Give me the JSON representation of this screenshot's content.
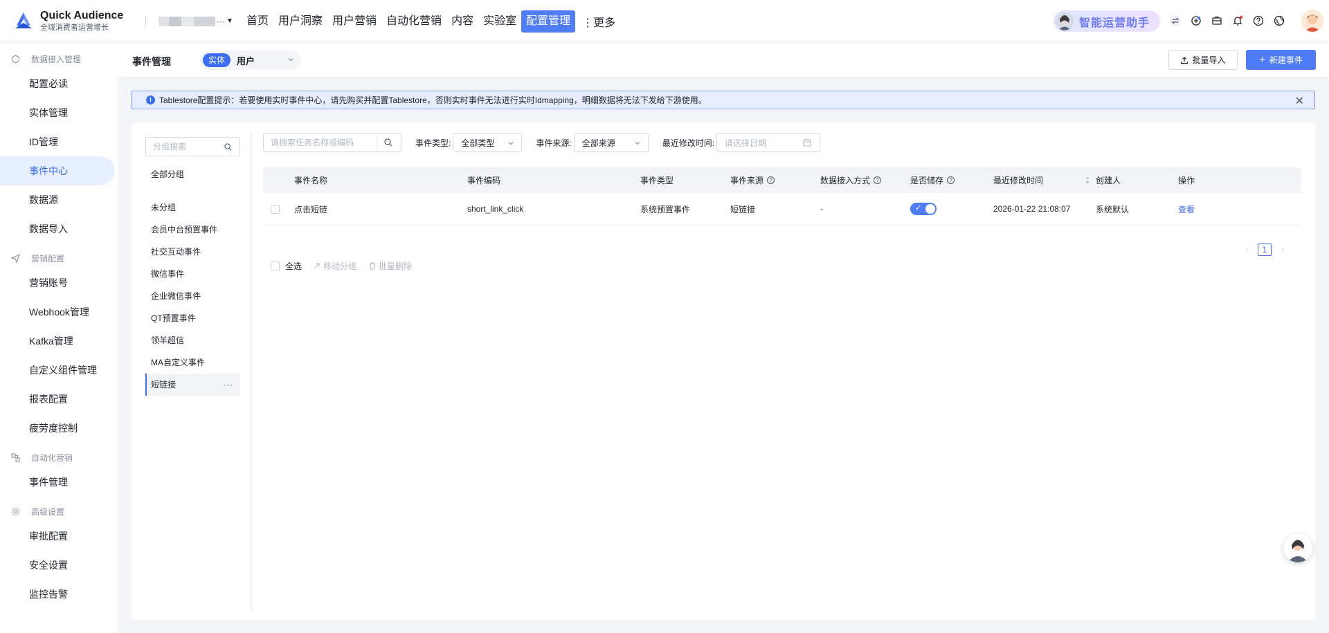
{
  "brand": {
    "name": "Quick Audience",
    "tagline": "全域消费者运营增长"
  },
  "tenant": {
    "dots": "···"
  },
  "topnav": {
    "items": [
      "首页",
      "用户洞察",
      "用户营销",
      "自动化营销",
      "内容",
      "实验室",
      "配置管理"
    ],
    "active_index": 6,
    "more": "⋮更多"
  },
  "assistant": {
    "label": "智能运营助手"
  },
  "header_icons": [
    "switch-icon",
    "ai-icon",
    "briefcase-icon",
    "bell-icon",
    "help-icon",
    "globe-icon"
  ],
  "sidebar": {
    "sections": [
      {
        "title": "数据接入管理",
        "icon": "data-icon",
        "items": [
          "配置必读",
          "实体管理",
          "ID管理",
          "事件中心",
          "数据源",
          "数据导入"
        ]
      },
      {
        "title": "营销配置",
        "icon": "send-icon",
        "items": [
          "营销账号",
          "Webhook管理",
          "Kafka管理",
          "自定义组件管理",
          "报表配置",
          "疲劳度控制"
        ]
      },
      {
        "title": "自动化营销",
        "icon": "flow-icon",
        "items": [
          "事件管理"
        ]
      },
      {
        "title": "高级设置",
        "icon": "settings-icon",
        "items": [
          "审批配置",
          "安全设置",
          "监控告警"
        ]
      }
    ],
    "active": "事件中心"
  },
  "subbar": {
    "title": "事件管理",
    "entity_tag": "实体",
    "entity_value": "用户",
    "import_label": "批量导入",
    "new_label": "新建事件"
  },
  "alert": {
    "message": "Tablestore配置提示：若要使用实时事件中心，请先购买并配置Tablestore，否则实时事件无法进行实时Idmapping，明细数据将无法下发给下游使用。"
  },
  "groups": {
    "search_placeholder": "分组搜索",
    "all": "全部分组",
    "items": [
      "未分组",
      "会员中台预置事件",
      "社交互动事件",
      "微信事件",
      "企业微信事件",
      "QT预置事件",
      "领羊超信",
      "MA自定义事件",
      "短链接"
    ],
    "selected": "短链接",
    "more": "···"
  },
  "filters": {
    "search_placeholder": "请搜索任务名称或编码",
    "type_label": "事件类型:",
    "type_value": "全部类型",
    "source_label": "事件来源:",
    "source_value": "全部来源",
    "time_label": "最近修改时间:",
    "time_placeholder": "请选择日期"
  },
  "table": {
    "columns": [
      "事件名称",
      "事件编码",
      "事件类型",
      "事件来源",
      "数据接入方式",
      "是否储存",
      "最近修改时间",
      "创建人",
      "操作"
    ],
    "rows": [
      {
        "name": "点击短链",
        "code": "short_link_click",
        "type": "系统预置事件",
        "source": "短链接",
        "access": "-",
        "stored": true,
        "modified": "2026-01-22 21:08:07",
        "creator": "系统默认",
        "action": "查看"
      }
    ]
  },
  "pagination": {
    "current": "1",
    "prev": "‹",
    "next": "›"
  },
  "bulk": {
    "select_all": "全选",
    "move": "移动分组",
    "delete": "批量删除"
  },
  "colors": {
    "primary": "#4f7df9",
    "active_bg": "#e8f0ff",
    "alert_bg": "#e8eeff"
  }
}
